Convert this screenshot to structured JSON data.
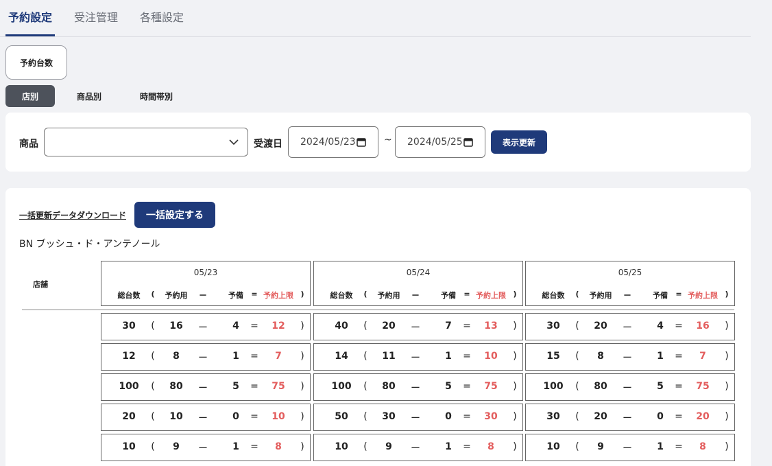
{
  "tabs": [
    "予約設定",
    "受注管理",
    "各種設定"
  ],
  "reservation_count_button": "予約台数",
  "view_tabs": [
    "店別",
    "商品別",
    "時間帯別"
  ],
  "filter": {
    "product_label": "商品",
    "product_value": "",
    "delivery_label": "受渡日",
    "date_from": "2024/05/23",
    "tilde": "~",
    "date_to": "2024/05/25",
    "refresh_button": "表示更新"
  },
  "actions": {
    "download_link": "一括更新データダウンロード",
    "bulk_button": "一括設定する"
  },
  "product_name": "BN ブッシュ・ド・アンテノール",
  "table": {
    "store_header": "店舗",
    "column_headers": {
      "total": "総台数",
      "open_paren": "(",
      "reserved": "予約用",
      "minus": "ー",
      "spare": "予備",
      "equals": "=",
      "limit": "予約上限",
      "close_paren": ")"
    },
    "dates": [
      "05/23",
      "05/24",
      "05/25"
    ],
    "rows": [
      [
        [
          30,
          16,
          4,
          12
        ],
        [
          40,
          20,
          7,
          13
        ],
        [
          30,
          20,
          4,
          16
        ]
      ],
      [
        [
          12,
          8,
          1,
          7
        ],
        [
          14,
          11,
          1,
          10
        ],
        [
          15,
          8,
          1,
          7
        ]
      ],
      [
        [
          100,
          80,
          5,
          75
        ],
        [
          100,
          80,
          5,
          75
        ],
        [
          100,
          80,
          5,
          75
        ]
      ],
      [
        [
          20,
          10,
          0,
          10
        ],
        [
          50,
          30,
          0,
          30
        ],
        [
          30,
          20,
          0,
          20
        ]
      ],
      [
        [
          10,
          9,
          1,
          8
        ],
        [
          10,
          9,
          1,
          8
        ],
        [
          10,
          9,
          1,
          8
        ]
      ]
    ]
  },
  "colors": {
    "accent": "#1f3a7a",
    "limit_red": "#e35d5d",
    "active_segment": "#4d525b"
  }
}
